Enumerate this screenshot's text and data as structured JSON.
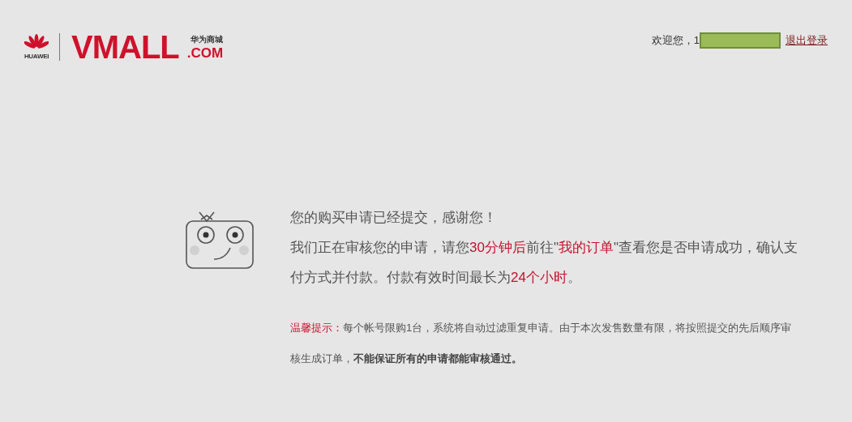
{
  "header": {
    "brand": "HUAWEI",
    "logo": "VMALL",
    "logo_tagline": "华为商城",
    "logo_suffix": ".COM",
    "welcome": "欢迎您，1",
    "logout": "退出登录"
  },
  "message": {
    "title": "您的购买申请已经提交，感谢您！",
    "body": [
      {
        "text": "我们正在审核您的申请，请您",
        "highlight": false
      },
      {
        "text": "30分钟后",
        "highlight": true
      },
      {
        "text": "前往\"",
        "highlight": false
      },
      {
        "text": "我的订单",
        "highlight": true
      },
      {
        "text": "\"查看您是否申请成功，确认支付方式并付款。付款有效时间最长为",
        "highlight": false
      },
      {
        "text": "24个小时",
        "highlight": true
      },
      {
        "text": "。",
        "highlight": false
      }
    ]
  },
  "tip": {
    "label": "温馨提示：",
    "text": "每个帐号限购1台，系统将自动过滤重复申请。由于本次发售数量有限，将按照提交的先后顺序审核生成订单，**不能保证所有的申请都能审核通过。**"
  }
}
